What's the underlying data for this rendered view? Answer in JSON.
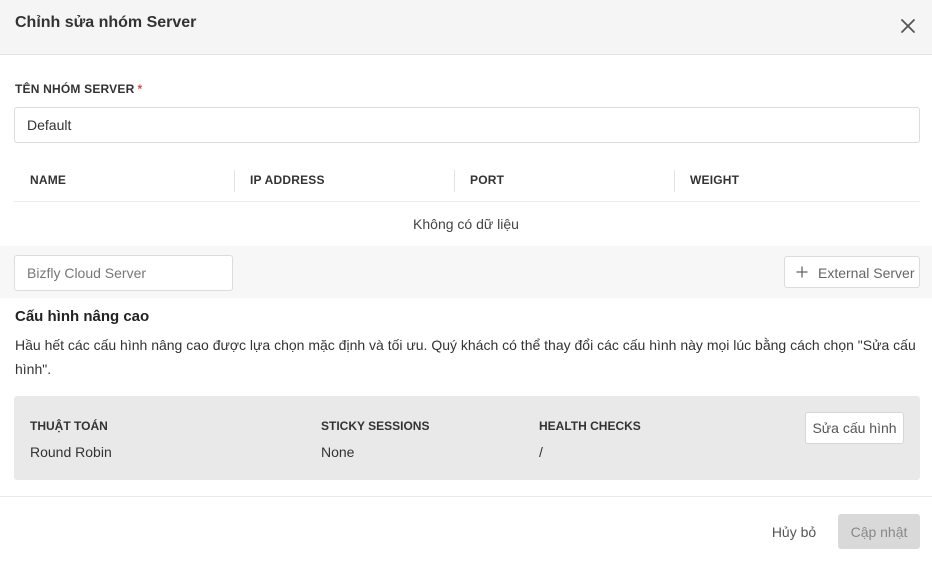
{
  "modal": {
    "title": "Chỉnh sửa nhóm Server",
    "close_icon": "close-icon"
  },
  "name_field": {
    "label": "TÊN NHÓM SERVER",
    "required_mark": "*",
    "value": "Default"
  },
  "table": {
    "columns": [
      "NAME",
      "IP ADDRESS",
      "PORT",
      "WEIGHT"
    ],
    "rows": [],
    "empty_text": "Không có dữ liệu"
  },
  "add_bar": {
    "server_select_placeholder": "Bizfly Cloud Server",
    "external_button": {
      "icon": "plus-icon",
      "label": "External Server"
    }
  },
  "advanced": {
    "title": "Cấu hình nâng cao",
    "description": "Hầu hết các cấu hình nâng cao được lựa chọn mặc định và tối ưu. Quý khách có thể thay đổi các cấu hình này mọi lúc bằng cách chọn \"Sửa cấu hình\".",
    "items": [
      {
        "label": "THUẬT TOÁN",
        "value": "Round Robin"
      },
      {
        "label": "STICKY SESSIONS",
        "value": "None"
      },
      {
        "label": "HEALTH CHECKS",
        "value": "/"
      }
    ],
    "edit_button": "Sửa cấu hình",
    "box_color": "#e9e9e9"
  },
  "footer": {
    "cancel_label": "Hủy bỏ",
    "update_label": "Cập nhật",
    "update_disabled": true
  }
}
